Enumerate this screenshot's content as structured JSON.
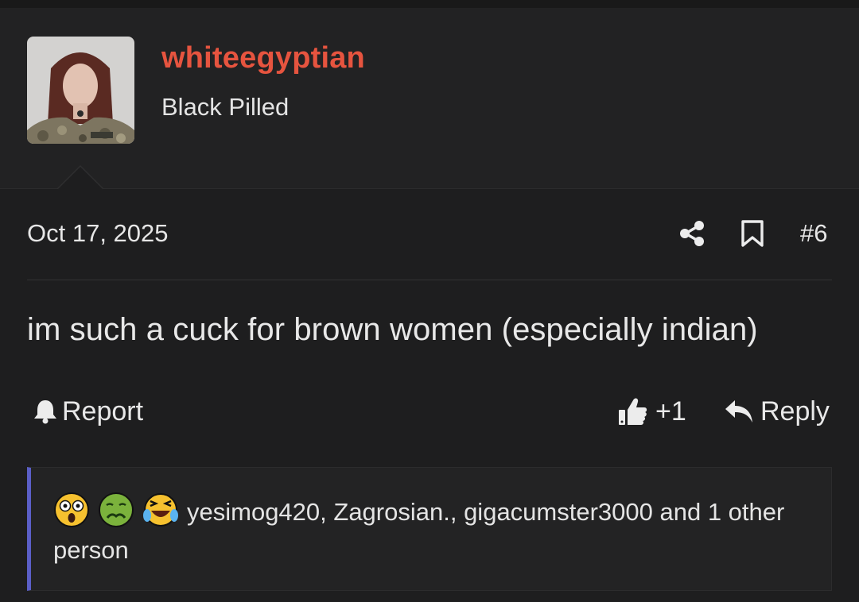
{
  "user": {
    "username": "whiteegyptian",
    "title": "Black Pilled",
    "accent_color": "#e6543f",
    "avatar": "avatar-photo"
  },
  "post": {
    "date": "Oct 17, 2025",
    "number": "#6",
    "content": "im such a cuck for brown women (especially indian)",
    "share_icon": "share-icon",
    "bookmark_icon": "bookmark-icon"
  },
  "actions": {
    "report_label": "Report",
    "report_icon": "bell-icon",
    "like_count": "+1",
    "like_icon": "thumbs-up-icon",
    "reply_label": "Reply",
    "reply_icon": "reply-arrow-icon"
  },
  "reactions": {
    "emojis": [
      "astonished-emoji",
      "nauseated-emoji",
      "crying-laughing-emoji"
    ],
    "summary": "yesimog420, Zagrosian., gigacumster3000 and 1 other person",
    "border_color": "#5b5fc7"
  }
}
